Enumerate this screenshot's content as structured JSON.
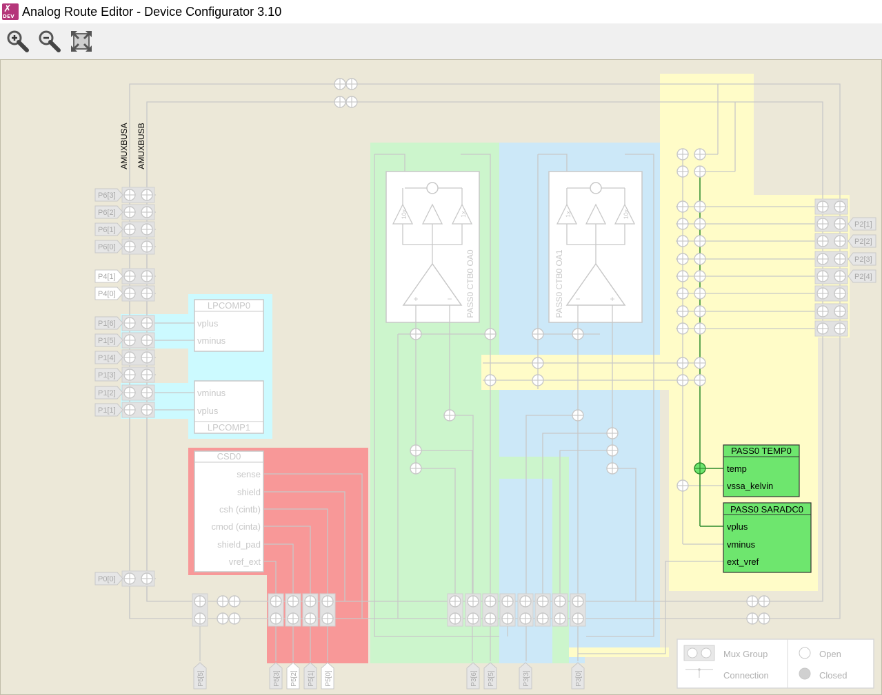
{
  "window": {
    "title": "Analog Route Editor - Device Configurator 3.10",
    "app_icon": "device-configurator-icon",
    "app_icon_text": "DEV"
  },
  "toolbar": {
    "buttons": [
      {
        "name": "zoom-in",
        "icon": "zoom-in-icon"
      },
      {
        "name": "zoom-out",
        "icon": "zoom-out-icon"
      },
      {
        "name": "zoom-fit",
        "icon": "zoom-fit-icon"
      }
    ]
  },
  "colors": {
    "canvas_bg": "#ece8d8",
    "green_region": "#ccf5cc",
    "blue_region": "#cce8f8",
    "yellow_region": "#fffcc8",
    "cyan_region": "#ccfaff",
    "red_region": "#f89898",
    "active_block": "#6ee66e",
    "active_wire": "#2a8a2a",
    "inactive_wire": "#c8c8c8"
  },
  "buses": {
    "amuxbusa": "AMUXBUSA",
    "amuxbusb": "AMUXBUSB"
  },
  "pins": {
    "left": [
      "P6[3]",
      "P6[2]",
      "P6[1]",
      "P6[0]",
      "P4[1]",
      "P4[0]",
      "P1[6]",
      "P1[5]",
      "P1[4]",
      "P1[3]",
      "P1[2]",
      "P1[1]",
      "P0[0]"
    ],
    "right": [
      "P2[1]",
      "P2[2]",
      "P2[3]",
      "P2[4]"
    ],
    "bottom": [
      "P5[5]",
      "P5[3]",
      "P5[2]",
      "P5[1]",
      "P5[0]",
      "P3[6]",
      "P3[5]",
      "P3[3]",
      "P3[0]"
    ]
  },
  "blocks": {
    "lpcomp0": {
      "title": "LPCOMP0",
      "ports": [
        "vplus",
        "vminus"
      ]
    },
    "lpcomp1": {
      "title": "LPCOMP1",
      "ports": [
        "vminus",
        "vplus"
      ]
    },
    "csd0": {
      "title": "CSD0",
      "ports": [
        "sense",
        "shield",
        "csh (cintb)",
        "cmod (cinta)",
        "shield_pad",
        "vref_ext"
      ]
    },
    "oa0": {
      "title": "PASS0 CTB0 OA0",
      "gains": [
        "10x",
        "1x"
      ]
    },
    "oa1": {
      "title": "PASS0 CTB0 OA1",
      "gains": [
        "1x",
        "10x"
      ]
    },
    "temp0": {
      "title": "PASS0 TEMP0",
      "ports": [
        "temp",
        "vssa_kelvin"
      ]
    },
    "saradc0": {
      "title": "PASS0 SARADC0",
      "ports": [
        "vplus",
        "vminus",
        "ext_vref"
      ]
    }
  },
  "legend": {
    "mux_group": "Mux Group",
    "connection": "Connection",
    "open": "Open",
    "closed": "Closed"
  }
}
